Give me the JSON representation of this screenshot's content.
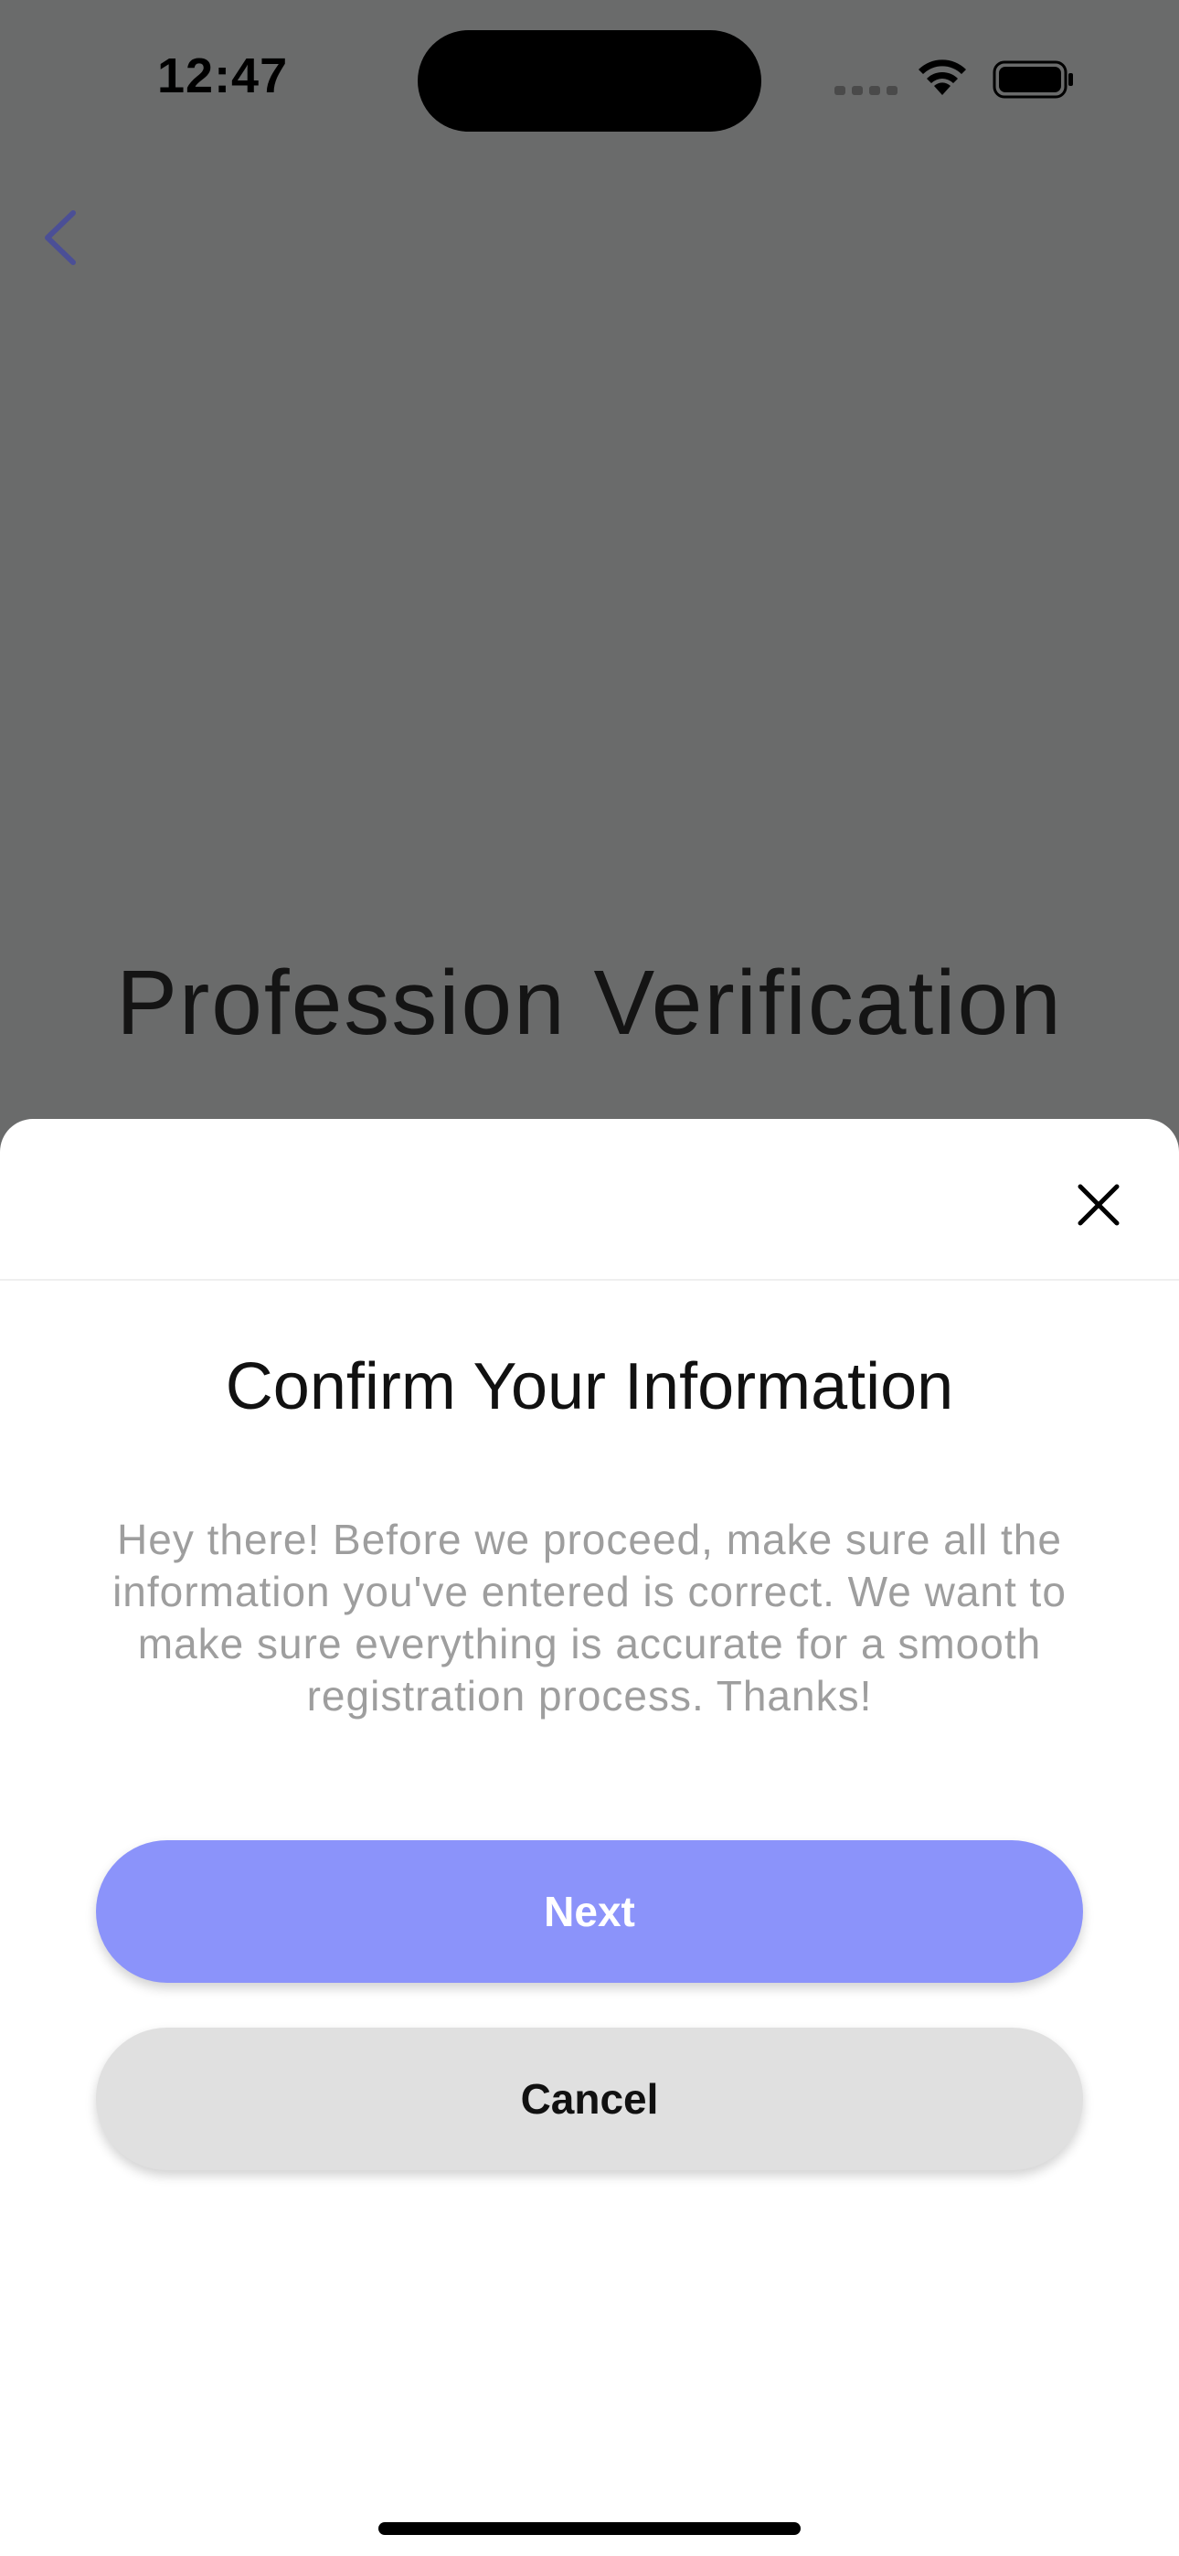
{
  "status_bar": {
    "time": "12:47"
  },
  "background_screen": {
    "title": "Profession Verification"
  },
  "sheet": {
    "title": "Confirm Your Information",
    "message": "Hey there! Before we proceed, make sure all the information you've entered is correct. We want to make sure everything is accurate for a smooth registration process. Thanks!",
    "next_label": "Next",
    "cancel_label": "Cancel"
  },
  "colors": {
    "accent": "#8b93fa",
    "back_chevron": "#4b4f96",
    "overlay": "#6a6b6b"
  },
  "icons": {
    "back": "chevron-left-icon",
    "close": "close-icon",
    "wifi": "wifi-icon",
    "battery": "battery-icon",
    "signal": "signal-icon"
  }
}
